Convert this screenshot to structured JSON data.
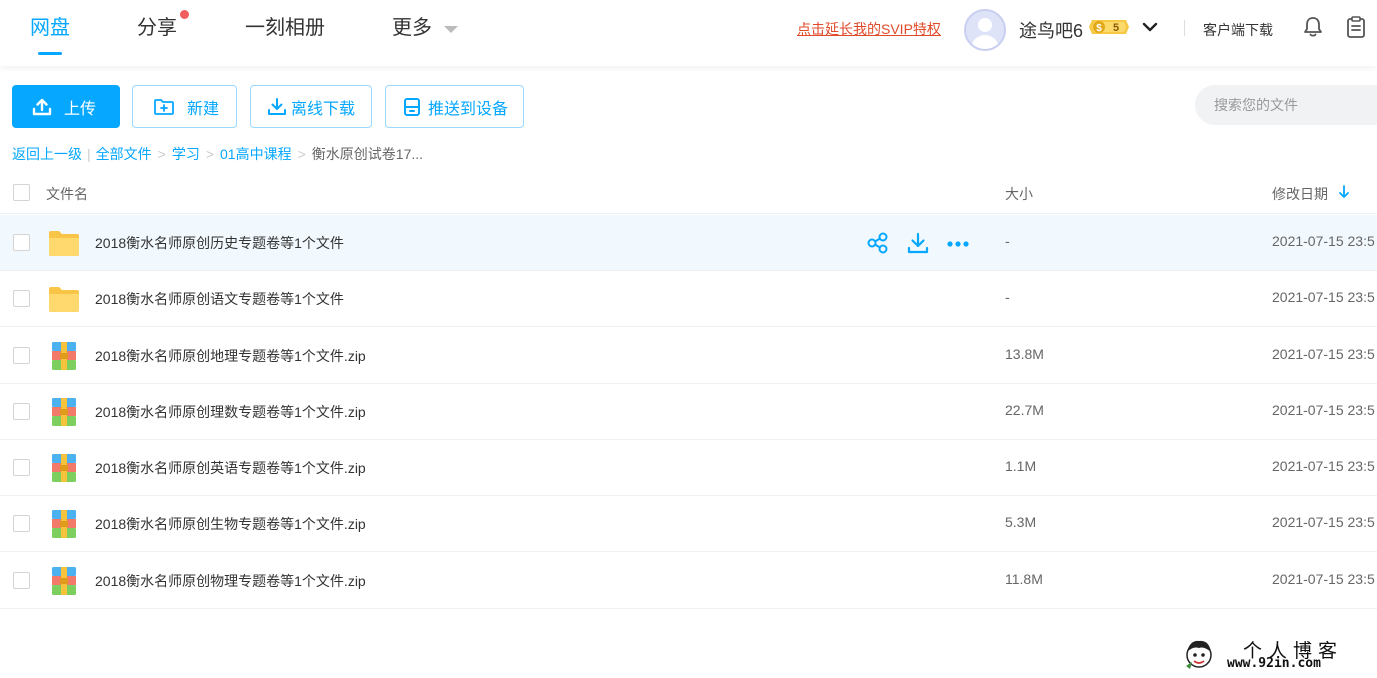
{
  "nav": {
    "items": [
      {
        "label": "网盘",
        "active": true
      },
      {
        "label": "分享",
        "has_notification": true
      },
      {
        "label": "一刻相册"
      },
      {
        "label": "更多",
        "has_dropdown": true
      }
    ]
  },
  "header": {
    "promo": "点击延长我的SVIP特权",
    "username": "途鸟吧6",
    "vip_badge": "5",
    "client_download": "客户端下载",
    "icons": [
      "bell-icon",
      "clipboard-icon"
    ]
  },
  "toolbar": {
    "upload": "上传",
    "new": "新建",
    "offline_download": "离线下载",
    "push_to_device": "推送到设备",
    "search_placeholder": "搜索您的文件"
  },
  "breadcrumb": {
    "back": "返回上一级",
    "items": [
      "全部文件",
      "学习",
      "01高中课程"
    ],
    "current": "衡水原创试卷17..."
  },
  "table": {
    "columns": {
      "name": "文件名",
      "size": "大小",
      "date": "修改日期"
    },
    "sort": {
      "column": "date",
      "direction": "desc"
    },
    "rows": [
      {
        "name": "2018衡水名师原创历史专题卷等1个文件",
        "size": "-",
        "date": "2021-07-15 23:5",
        "type": "folder",
        "hover": true
      },
      {
        "name": "2018衡水名师原创语文专题卷等1个文件",
        "size": "-",
        "date": "2021-07-15 23:5",
        "type": "folder"
      },
      {
        "name": "2018衡水名师原创地理专题卷等1个文件.zip",
        "size": "13.8M",
        "date": "2021-07-15 23:5",
        "type": "zip"
      },
      {
        "name": "2018衡水名师原创理数专题卷等1个文件.zip",
        "size": "22.7M",
        "date": "2021-07-15 23:5",
        "type": "zip"
      },
      {
        "name": "2018衡水名师原创英语专题卷等1个文件.zip",
        "size": "1.1M",
        "date": "2021-07-15 23:5",
        "type": "zip"
      },
      {
        "name": "2018衡水名师原创生物专题卷等1个文件.zip",
        "size": "5.3M",
        "date": "2021-07-15 23:5",
        "type": "zip"
      },
      {
        "name": "2018衡水名师原创物理专题卷等1个文件.zip",
        "size": "11.8M",
        "date": "2021-07-15 23:5",
        "type": "zip"
      }
    ],
    "row_actions": [
      "share-icon",
      "download-icon",
      "more-icon"
    ]
  },
  "watermark": {
    "title": "个人博客",
    "url": "www.92in.com"
  },
  "colors": {
    "accent": "#06a7ff",
    "promo": "#e04a28",
    "notification": "#f25d5d",
    "folder": "#ffd05b",
    "hover_row": "#f2f9fe"
  }
}
